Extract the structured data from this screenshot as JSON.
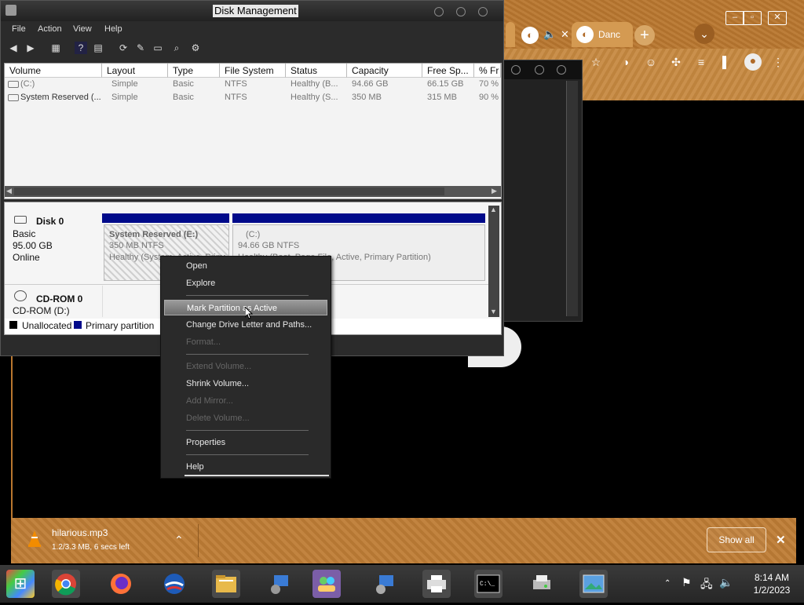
{
  "disk_mgmt": {
    "title": "Disk Management",
    "menu": [
      "File",
      "Action",
      "View",
      "Help"
    ],
    "columns": [
      "Volume",
      "Layout",
      "Type",
      "File System",
      "Status",
      "Capacity",
      "Free Sp...",
      "% Fr"
    ],
    "rows": [
      [
        "(C:)",
        "Simple",
        "Basic",
        "NTFS",
        "Healthy (B...",
        "94.66 GB",
        "66.15 GB",
        "70 %"
      ],
      [
        "System Reserved (...",
        "Simple",
        "Basic",
        "NTFS",
        "Healthy (S...",
        "350 MB",
        "315 MB",
        "90 %"
      ]
    ],
    "disk0": {
      "name": "Disk 0",
      "type": "Basic",
      "size": "95.00 GB",
      "state": "Online",
      "partitions": [
        {
          "name": "System Reserved  (E:)",
          "size": "350 MB NTFS",
          "status": "Healthy (System, Active, Primary Partition)"
        },
        {
          "name": "(C:)",
          "size": "94.66 GB NTFS",
          "status": "Healthy (Boot, Page File, Active, Primary Partition)"
        }
      ]
    },
    "cdrom": {
      "name": "CD-ROM 0",
      "drive": "CD-ROM (D:)"
    },
    "legend": {
      "unallocated": "Unallocated",
      "primary": "Primary partition"
    },
    "colors": {
      "primary": "#000a8a",
      "unallocated": "#000000"
    }
  },
  "context_menu": {
    "items": [
      {
        "label": "Open",
        "disabled": false
      },
      {
        "label": "Explore",
        "disabled": false
      },
      {
        "label": "Mark Partition as Active",
        "disabled": false,
        "highlighted": true
      },
      {
        "label": "Change Drive Letter and Paths...",
        "disabled": false
      },
      {
        "label": "Format...",
        "disabled": true
      },
      {
        "label": "Extend Volume...",
        "disabled": true
      },
      {
        "label": "Shrink Volume...",
        "disabled": false
      },
      {
        "label": "Add Mirror...",
        "disabled": true
      },
      {
        "label": "Delete Volume...",
        "disabled": true
      },
      {
        "label": "Properties",
        "disabled": false
      },
      {
        "label": "Help",
        "disabled": false
      }
    ]
  },
  "browser": {
    "tab_label": "Danc",
    "accent": "#bf7d36"
  },
  "download": {
    "filename": "hilarious.mp3",
    "progress": "1.2/3.3 MB, 6 secs left",
    "show_all": "Show all"
  },
  "taskbar": {
    "time": "8:14 AM",
    "date": "1/2/2023"
  }
}
